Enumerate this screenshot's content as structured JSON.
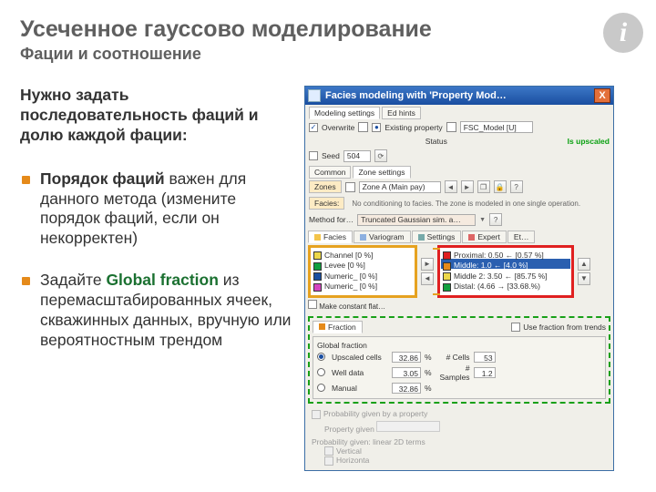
{
  "title": "Усеченное гауссово моделирование",
  "subtitle": "Фации и соотношение",
  "intro": "Нужно задать последовательность фаций и долю каждой фации:",
  "bullet1_a": "Порядок фаций",
  "bullet1_b": " важен для данного метода (измените порядок фаций, если он некорректен)",
  "bullet2_a": "Задайте ",
  "bullet2_b": "Global fraction",
  "bullet2_c": " из перемасштабированных ячеек, скважинных данных, вручную или вероятностным трендом",
  "win": {
    "title": "Facies modeling with 'Property Mod…",
    "close": "X",
    "topTabs": {
      "a": "Modeling settings",
      "b": "Ed hints"
    },
    "overwrite_label": "Overwrite",
    "existing_label": "Existing property",
    "prop_field": "FSC_Model [U]",
    "status_lbl": "Status",
    "status_val": "Is upscaled",
    "seed_lbl": "Seed",
    "seed_val": "504",
    "toolTabs": {
      "common": "Common",
      "zone": "Zone settings"
    },
    "zones_btn": "Zones",
    "zone_field": "Zone A (Main pay)",
    "facies_btn": "Facies:",
    "facies_note": "No conditioning to facies. The zone is modeled in one single operation.",
    "method_lbl": "Method for…",
    "method_field": "Truncated Gaussian sim. a…",
    "innerTabs": {
      "facies": "Facies",
      "vario": "Variogram",
      "settings": "Settings",
      "expert": "Expert",
      "etc": "Et…"
    },
    "faciesLeft": [
      "Channel [0 %]",
      "Levee [0 %]",
      "Numeric_ [0 %]",
      "Numeric_ [0 %]"
    ],
    "faciesRight": [
      "Proximal: 0.50 ← [0.57 %]",
      "Middle: 1.0 ← [4.0 %]",
      "Middle 2: 3.50 ← [85.75 %]",
      "Distal: (4.66 → [33.68.%)"
    ],
    "group_footer": "Make constant flat…",
    "fraction": {
      "tab": "Fraction",
      "trend_chk": "Use fraction from trends",
      "global_lbl": "Global fraction",
      "upscaled": "Upscaled cells",
      "upscaled_v": "32.86",
      "upscaled_n_lbl": "# Cells",
      "upscaled_n": "53",
      "well": "Well data",
      "well_v": "3.05",
      "well_n_lbl": "# Samples",
      "well_n": "1.2",
      "manual": "Manual",
      "manual_v": "32.86",
      "pct": "%"
    },
    "trend": {
      "prob_given": "Probability given by a property",
      "prop_lbl": "Property given",
      "hdr": "Probability given: linear 2D terms",
      "vertical": "Vertical",
      "horizonta": "Horizonta"
    }
  }
}
